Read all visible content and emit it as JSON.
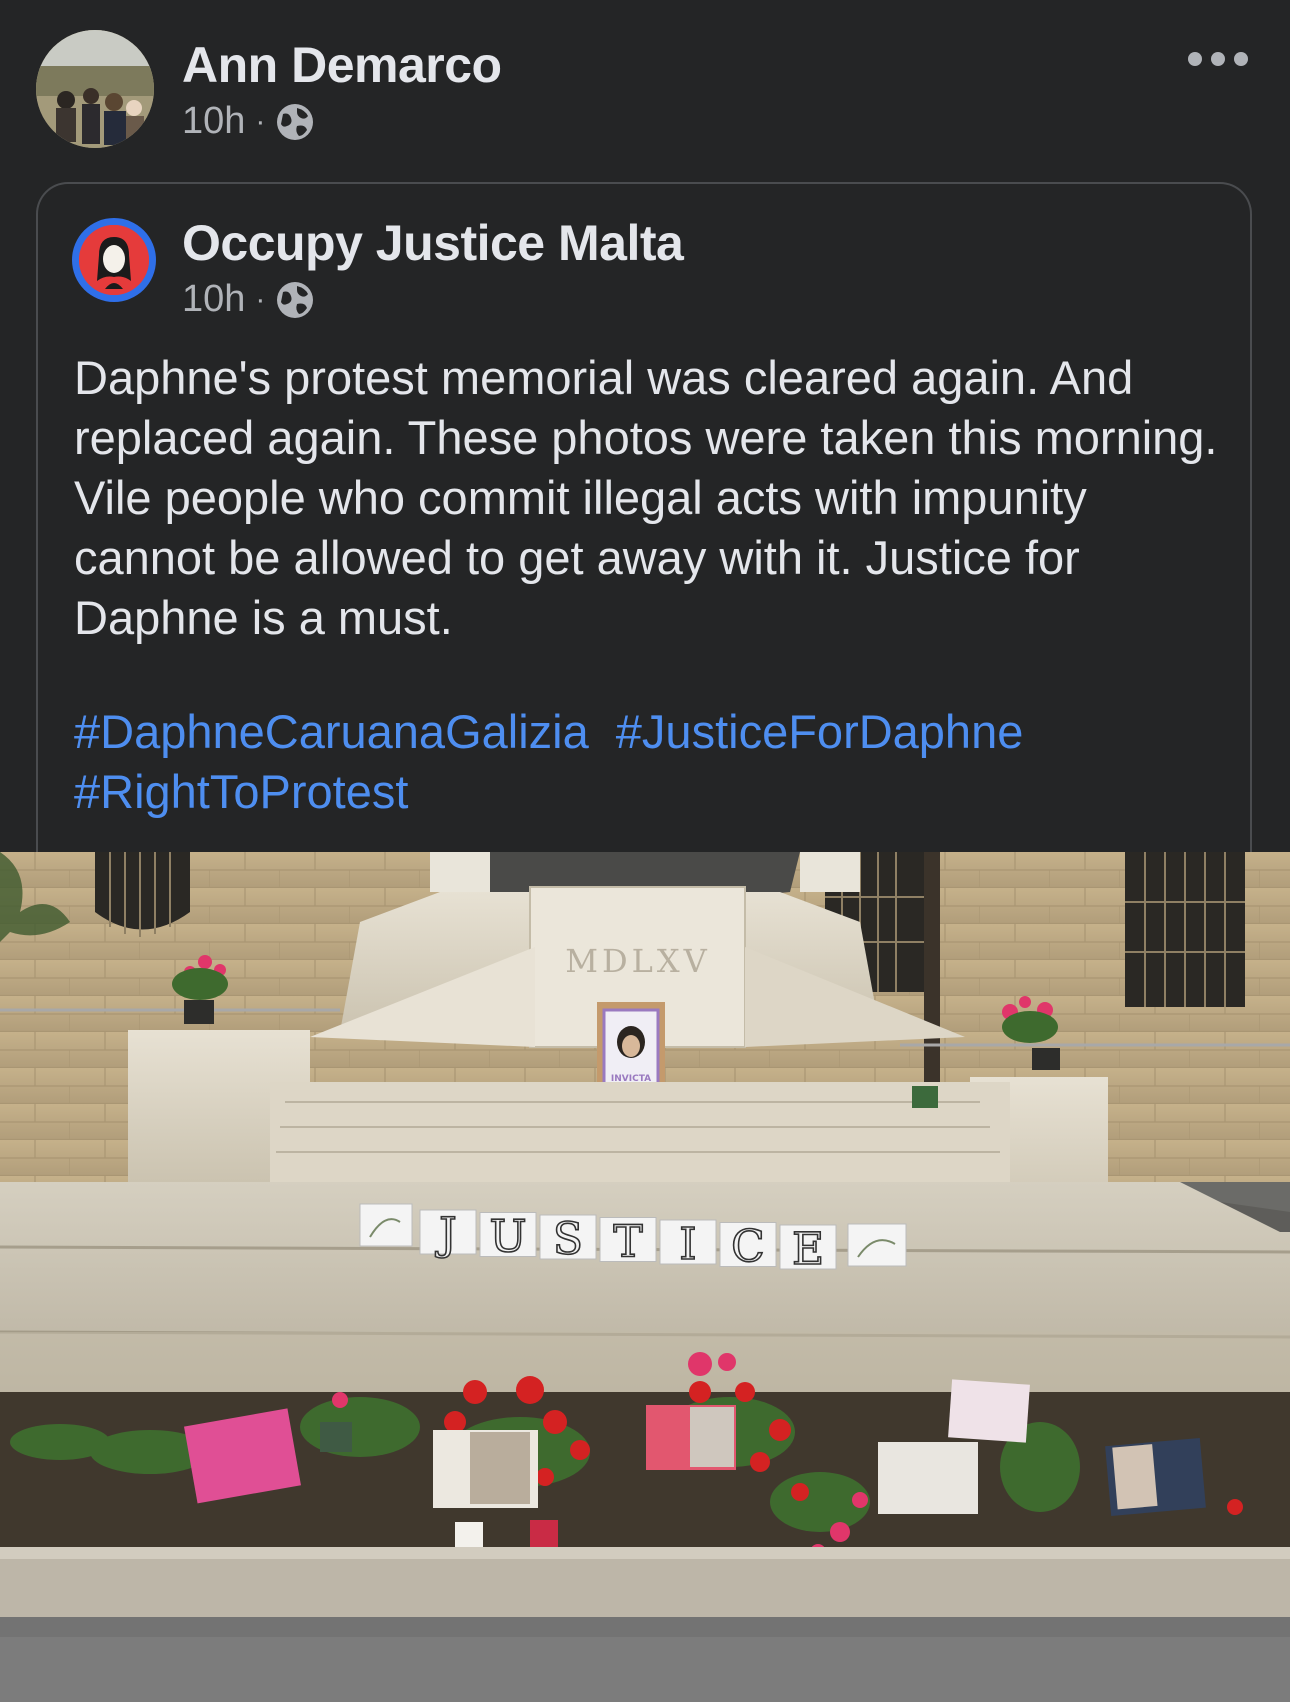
{
  "post": {
    "author": "Ann Demarco",
    "time": "10h",
    "separator": "·",
    "visibility_icon": "globe-icon",
    "more_icon": "more-options-icon"
  },
  "shared": {
    "page_name": "Occupy Justice Malta",
    "time": "10h",
    "separator": "·",
    "text": "Daphne's protest memorial was cleared again. And replaced again. These photos were taken this morning. Vile people who commit illegal acts with impunity cannot be allowed to get away with it. Justice for Daphne is a must.",
    "hashtags": [
      "#DaphneCaruanaGalizia",
      "#JusticeForDaphne",
      "#RightToProtest"
    ]
  },
  "photo": {
    "inscription": "MDLXV",
    "frame_caption": "INVICTA",
    "justice_letters": [
      "J",
      "U",
      "S",
      "T",
      "I",
      "C",
      "E"
    ]
  },
  "colors": {
    "background": "#242526",
    "text": "#e4e6eb",
    "secondary_text": "#b0b3b8",
    "hashtag": "#4e8ef0",
    "page_ring": "#2f6fe8"
  }
}
